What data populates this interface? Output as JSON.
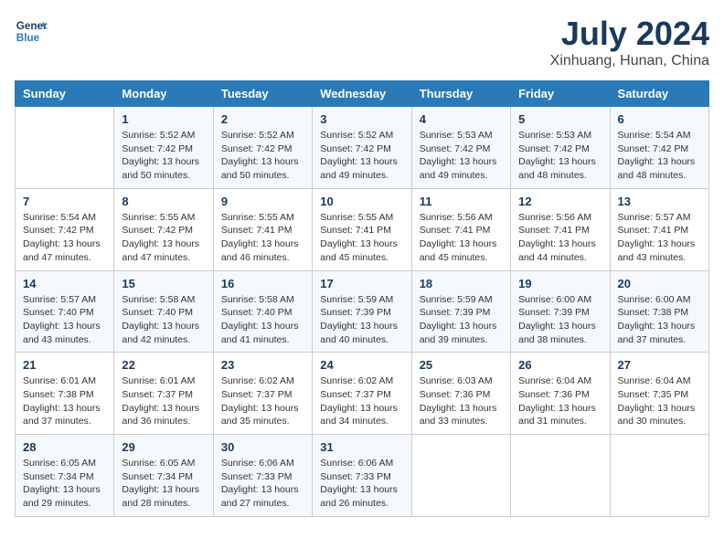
{
  "header": {
    "logo_line1": "General",
    "logo_line2": "Blue",
    "title": "July 2024",
    "subtitle": "Xinhuang, Hunan, China"
  },
  "calendar": {
    "days_of_week": [
      "Sunday",
      "Monday",
      "Tuesday",
      "Wednesday",
      "Thursday",
      "Friday",
      "Saturday"
    ],
    "weeks": [
      [
        {
          "day": "",
          "info": ""
        },
        {
          "day": "1",
          "info": "Sunrise: 5:52 AM\nSunset: 7:42 PM\nDaylight: 13 hours\nand 50 minutes."
        },
        {
          "day": "2",
          "info": "Sunrise: 5:52 AM\nSunset: 7:42 PM\nDaylight: 13 hours\nand 50 minutes."
        },
        {
          "day": "3",
          "info": "Sunrise: 5:52 AM\nSunset: 7:42 PM\nDaylight: 13 hours\nand 49 minutes."
        },
        {
          "day": "4",
          "info": "Sunrise: 5:53 AM\nSunset: 7:42 PM\nDaylight: 13 hours\nand 49 minutes."
        },
        {
          "day": "5",
          "info": "Sunrise: 5:53 AM\nSunset: 7:42 PM\nDaylight: 13 hours\nand 48 minutes."
        },
        {
          "day": "6",
          "info": "Sunrise: 5:54 AM\nSunset: 7:42 PM\nDaylight: 13 hours\nand 48 minutes."
        }
      ],
      [
        {
          "day": "7",
          "info": "Sunrise: 5:54 AM\nSunset: 7:42 PM\nDaylight: 13 hours\nand 47 minutes."
        },
        {
          "day": "8",
          "info": "Sunrise: 5:55 AM\nSunset: 7:42 PM\nDaylight: 13 hours\nand 47 minutes."
        },
        {
          "day": "9",
          "info": "Sunrise: 5:55 AM\nSunset: 7:41 PM\nDaylight: 13 hours\nand 46 minutes."
        },
        {
          "day": "10",
          "info": "Sunrise: 5:55 AM\nSunset: 7:41 PM\nDaylight: 13 hours\nand 45 minutes."
        },
        {
          "day": "11",
          "info": "Sunrise: 5:56 AM\nSunset: 7:41 PM\nDaylight: 13 hours\nand 45 minutes."
        },
        {
          "day": "12",
          "info": "Sunrise: 5:56 AM\nSunset: 7:41 PM\nDaylight: 13 hours\nand 44 minutes."
        },
        {
          "day": "13",
          "info": "Sunrise: 5:57 AM\nSunset: 7:41 PM\nDaylight: 13 hours\nand 43 minutes."
        }
      ],
      [
        {
          "day": "14",
          "info": "Sunrise: 5:57 AM\nSunset: 7:40 PM\nDaylight: 13 hours\nand 43 minutes."
        },
        {
          "day": "15",
          "info": "Sunrise: 5:58 AM\nSunset: 7:40 PM\nDaylight: 13 hours\nand 42 minutes."
        },
        {
          "day": "16",
          "info": "Sunrise: 5:58 AM\nSunset: 7:40 PM\nDaylight: 13 hours\nand 41 minutes."
        },
        {
          "day": "17",
          "info": "Sunrise: 5:59 AM\nSunset: 7:39 PM\nDaylight: 13 hours\nand 40 minutes."
        },
        {
          "day": "18",
          "info": "Sunrise: 5:59 AM\nSunset: 7:39 PM\nDaylight: 13 hours\nand 39 minutes."
        },
        {
          "day": "19",
          "info": "Sunrise: 6:00 AM\nSunset: 7:39 PM\nDaylight: 13 hours\nand 38 minutes."
        },
        {
          "day": "20",
          "info": "Sunrise: 6:00 AM\nSunset: 7:38 PM\nDaylight: 13 hours\nand 37 minutes."
        }
      ],
      [
        {
          "day": "21",
          "info": "Sunrise: 6:01 AM\nSunset: 7:38 PM\nDaylight: 13 hours\nand 37 minutes."
        },
        {
          "day": "22",
          "info": "Sunrise: 6:01 AM\nSunset: 7:37 PM\nDaylight: 13 hours\nand 36 minutes."
        },
        {
          "day": "23",
          "info": "Sunrise: 6:02 AM\nSunset: 7:37 PM\nDaylight: 13 hours\nand 35 minutes."
        },
        {
          "day": "24",
          "info": "Sunrise: 6:02 AM\nSunset: 7:37 PM\nDaylight: 13 hours\nand 34 minutes."
        },
        {
          "day": "25",
          "info": "Sunrise: 6:03 AM\nSunset: 7:36 PM\nDaylight: 13 hours\nand 33 minutes."
        },
        {
          "day": "26",
          "info": "Sunrise: 6:04 AM\nSunset: 7:36 PM\nDaylight: 13 hours\nand 31 minutes."
        },
        {
          "day": "27",
          "info": "Sunrise: 6:04 AM\nSunset: 7:35 PM\nDaylight: 13 hours\nand 30 minutes."
        }
      ],
      [
        {
          "day": "28",
          "info": "Sunrise: 6:05 AM\nSunset: 7:34 PM\nDaylight: 13 hours\nand 29 minutes."
        },
        {
          "day": "29",
          "info": "Sunrise: 6:05 AM\nSunset: 7:34 PM\nDaylight: 13 hours\nand 28 minutes."
        },
        {
          "day": "30",
          "info": "Sunrise: 6:06 AM\nSunset: 7:33 PM\nDaylight: 13 hours\nand 27 minutes."
        },
        {
          "day": "31",
          "info": "Sunrise: 6:06 AM\nSunset: 7:33 PM\nDaylight: 13 hours\nand 26 minutes."
        },
        {
          "day": "",
          "info": ""
        },
        {
          "day": "",
          "info": ""
        },
        {
          "day": "",
          "info": ""
        }
      ]
    ]
  }
}
